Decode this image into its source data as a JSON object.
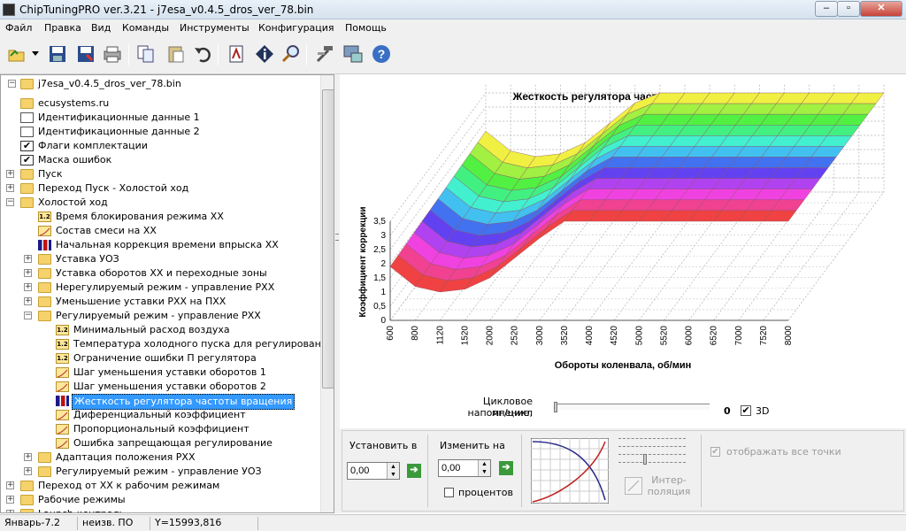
{
  "window": {
    "title": "ChipTuningPRO ver.3.21 - j7esa_v0.4.5_dros_ver_78.bin",
    "min": "–",
    "max": "▫",
    "close": "✕"
  },
  "menu": [
    "Файл",
    "Правка",
    "Вид",
    "Команды",
    "Инструменты",
    "Конфигурация",
    "Помощь"
  ],
  "toolbar": {
    "icons": [
      "open-icon",
      "save-icon",
      "save-as-icon",
      "print-icon",
      "copy-icon",
      "paste-icon",
      "undo-icon",
      "compare-icon",
      "info-icon",
      "search-icon",
      "tools-icon",
      "connect-icon",
      "help-icon"
    ]
  },
  "tree": {
    "root": "j7esa_v0.4.5_dros_ver_78.bin",
    "items": [
      {
        "label": "ecusystems.ru",
        "icon": "folder"
      },
      {
        "label": "Идентификационные данные 1",
        "icon": "doc"
      },
      {
        "label": "Идентификационные данные 2",
        "icon": "doc"
      },
      {
        "label": "Флаги комплектации",
        "icon": "check"
      },
      {
        "label": "Маска ошибок",
        "icon": "check"
      },
      {
        "label": "Пуск",
        "icon": "folder"
      },
      {
        "label": "Переход Пуск - Холостой ход",
        "icon": "folder"
      },
      {
        "label": "Холостой ход",
        "icon": "folder"
      },
      {
        "label": "Время блокирования режима ХХ",
        "icon": "num"
      },
      {
        "label": "Состав смеси на ХХ",
        "icon": "curve"
      },
      {
        "label": "Начальная коррекция времени впрыска ХХ",
        "icon": "bar"
      },
      {
        "label": "Уставка УОЗ",
        "icon": "folder"
      },
      {
        "label": "Уставка оборотов ХХ и переходные зоны",
        "icon": "folder"
      },
      {
        "label": "Нерегулируемый режим - управление РХХ",
        "icon": "folder"
      },
      {
        "label": "Уменьшение уставки РХХ на ПХХ",
        "icon": "folder"
      },
      {
        "label": "Регулируемый режим - управление РХХ",
        "icon": "folder"
      },
      {
        "label": "Минимальный расход воздуха",
        "icon": "num"
      },
      {
        "label": "Температура холодного пуска для регулирования",
        "icon": "num"
      },
      {
        "label": "Ограничение ошибки П регулятора",
        "icon": "num"
      },
      {
        "label": "Шаг уменьшения уставки оборотов 1",
        "icon": "curve"
      },
      {
        "label": "Шаг уменьшения уставки оборотов 2",
        "icon": "curve"
      },
      {
        "label": "Жесткость регулятора частоты вращения",
        "icon": "bar"
      },
      {
        "label": "Диференциальный коэффициент",
        "icon": "curve"
      },
      {
        "label": "Пропорциональный коэффициент",
        "icon": "curve"
      },
      {
        "label": "Ошибка запрещающая регулирование",
        "icon": "curve"
      },
      {
        "label": "Адаптация положения РХХ",
        "icon": "folder"
      },
      {
        "label": "Регулируемый режим - управление УОЗ",
        "icon": "folder"
      },
      {
        "label": "Переход от ХХ к рабочим режимам",
        "icon": "folder"
      },
      {
        "label": "Рабочие режимы",
        "icon": "folder"
      },
      {
        "label": "Launch-контроль",
        "icon": "folder"
      }
    ]
  },
  "chart_data": {
    "type": "surface3d",
    "title": "Жесткость регулятора частоты вращения",
    "xlabel": "Обороты коленвала, об/мин",
    "ylabel": "Коэффициент коррекции",
    "x": [
      "600",
      "800",
      "1120",
      "1520",
      "2000",
      "2520",
      "3000",
      "3520",
      "4000",
      "4520",
      "5000",
      "5520",
      "6000",
      "6520",
      "7000",
      "7520",
      "8000"
    ],
    "yticks": [
      "0",
      "0,5",
      "1",
      "1,5",
      "2",
      "2,5",
      "3",
      "3,5"
    ],
    "ylim": [
      0,
      3.5
    ],
    "front_profile": [
      1.9,
      1.2,
      1.0,
      1.1,
      1.5,
      2.2,
      2.9,
      3.5,
      3.5,
      3.5,
      3.5,
      3.5,
      3.5,
      3.5,
      3.5,
      3.5,
      3.5
    ]
  },
  "controls": {
    "fill_label_1": "Цикловое наполнение,",
    "fill_label_2": "мг/цикл",
    "fill_value": "0",
    "mode_3d": "3D",
    "set_label": "Установить в",
    "set_value": "0,00",
    "change_label": "Изменить на",
    "change_value": "0,00",
    "percent_label": "процентов",
    "interp_label": "Интер-\nполяция",
    "show_all_label": "отображать все точки"
  },
  "status": {
    "cell1": "Январь-7.2",
    "cell2": "неизв. ПО",
    "cell3": "Y=15993,816"
  }
}
